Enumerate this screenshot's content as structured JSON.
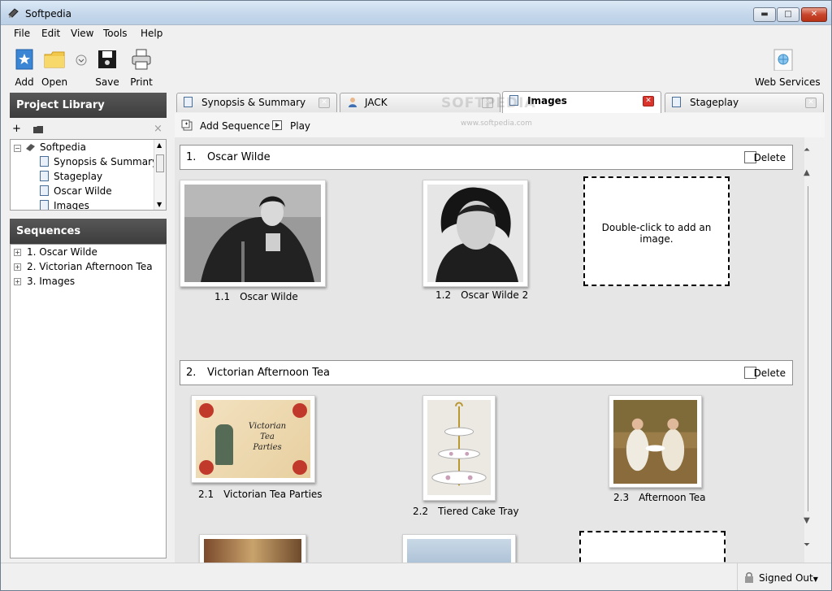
{
  "window": {
    "title": "Softpedia"
  },
  "menu": [
    "File",
    "Edit",
    "View",
    "Tools",
    "Help"
  ],
  "toolbar": {
    "add": "Add",
    "open": "Open",
    "save": "Save",
    "print": "Print",
    "web_services": "Web Services"
  },
  "project_library": {
    "title": "Project Library",
    "tree": [
      "Softpedia",
      "Synopsis & Summary",
      "Stageplay",
      "Oscar Wilde",
      "Images"
    ]
  },
  "sequences": {
    "title": "Sequences",
    "items": [
      "1. Oscar Wilde",
      "2. Victorian Afternoon Tea",
      "3. Images"
    ]
  },
  "tabs": [
    {
      "label": "Synopsis & Summary",
      "icon": "document-icon"
    },
    {
      "label": "JACK",
      "icon": "person-icon"
    },
    {
      "label": "Images",
      "icon": "images-icon",
      "active": true
    },
    {
      "label": "Stageplay",
      "icon": "stageplay-icon"
    }
  ],
  "watermark": {
    "logo": "SOFTPEDIA",
    "url": "www.softpedia.com"
  },
  "actions": {
    "add_sequence": "Add Sequence",
    "play": "Play"
  },
  "sections": [
    {
      "num": "1.",
      "name": "Oscar Wilde",
      "delete": "Delete",
      "images": [
        {
          "num": "1.1",
          "caption": "Oscar Wilde"
        },
        {
          "num": "1.2",
          "caption": "Oscar Wilde 2"
        }
      ],
      "placeholder": "Double-click to add an image."
    },
    {
      "num": "2.",
      "name": "Victorian Afternoon Tea",
      "delete": "Delete",
      "images": [
        {
          "num": "2.1",
          "caption": "Victorian Tea Parties",
          "image_text": "Victorian Tea Parties"
        },
        {
          "num": "2.2",
          "caption": "Tiered Cake Tray"
        },
        {
          "num": "2.3",
          "caption": "Afternoon Tea"
        }
      ]
    }
  ],
  "status": {
    "signed": "Signed Out"
  }
}
